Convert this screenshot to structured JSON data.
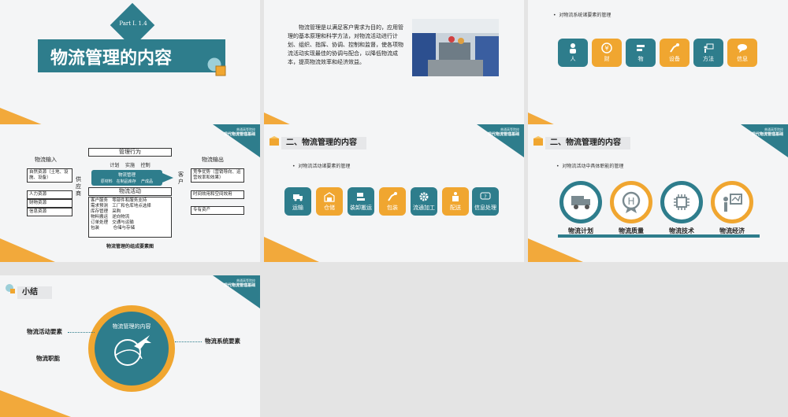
{
  "slide1": {
    "part_label": "Part I. 1.4",
    "title": "物流管理的内容"
  },
  "slide2": {
    "paragraph": "物流管理是以满足客户需求为目的，应用管理的基本原理和科学方法，对物流活动进行计划、组织、指挥、协调、控制和监督，使各项物流活动实现最佳的协调与配合，以降低物流成本，提高物流效率和经济效益。"
  },
  "slide3": {
    "bullet": "对物流系统诸要素的管理",
    "tiles": [
      {
        "label": "人",
        "color": "teal",
        "icon": "person-icon"
      },
      {
        "label": "财",
        "color": "orange",
        "icon": "money-icon"
      },
      {
        "label": "物",
        "color": "teal",
        "icon": "goods-icon"
      },
      {
        "label": "设备",
        "color": "orange",
        "icon": "robot-arm-icon"
      },
      {
        "label": "方法",
        "color": "teal",
        "icon": "presentation-icon"
      },
      {
        "label": "信息",
        "color": "orange",
        "icon": "chat-icon"
      }
    ]
  },
  "slide4": {
    "header": {
      "line1": "普通高等院校",
      "line2": "现代物流管理基础"
    },
    "input_title": "物流输入",
    "inputs": [
      "自然资源（土地、设施、设备）",
      "人力资源",
      "财物资源",
      "信息资源"
    ],
    "supplier": "供应商",
    "mgmt_title": "管理行为",
    "mgmt_items": "计划    实施    控制",
    "center_title": "物流管理",
    "center_flow": "原材料   在制品库存    产成品",
    "customer": "客户",
    "activity_title": "物流活动",
    "activities": [
      "客户服务   零部件和服务支持",
      "需求预测   工厂和仓库地点选择",
      "库存管理   采购",
      "物料搬运   逆向物流",
      "订单处理   交通与运输",
      "包装          仓储与存储"
    ],
    "output_title": "物流输出",
    "outputs": [
      "竞争优势（营销导向、运营效率和效果）",
      "时间效用和空间效用",
      "专有资产"
    ],
    "caption": "物流管理的组成要素图"
  },
  "slide5": {
    "header": {
      "line1": "普通高等院校",
      "line2": "现代物流管理基础"
    },
    "title": "二、物流管理的内容",
    "bullet": "对物流活动诸要素的管理",
    "tiles": [
      {
        "label": "运输",
        "color": "teal",
        "icon": "truck-icon"
      },
      {
        "label": "仓储",
        "color": "orange",
        "icon": "warehouse-icon"
      },
      {
        "label": "装卸搬运",
        "color": "teal",
        "icon": "handling-icon"
      },
      {
        "label": "包装",
        "color": "orange",
        "icon": "robot-arm-icon"
      },
      {
        "label": "流通加工",
        "color": "teal",
        "icon": "gear-icon"
      },
      {
        "label": "配送",
        "color": "orange",
        "icon": "delivery-icon"
      },
      {
        "label": "信息处理",
        "color": "teal",
        "icon": "info-icon"
      }
    ]
  },
  "slide6": {
    "header": {
      "line1": "普通高等院校",
      "line2": "现代物流管理基础"
    },
    "title": "二、物流管理的内容",
    "bullet": "对物流活动中具体职能的管理",
    "circles": [
      {
        "label": "物流计划",
        "color": "teal",
        "icon": "truck-icon"
      },
      {
        "label": "物流质量",
        "color": "orange",
        "icon": "quality-badge-icon"
      },
      {
        "label": "物流技术",
        "color": "teal",
        "icon": "chip-icon"
      },
      {
        "label": "物流经济",
        "color": "orange",
        "icon": "presenter-icon"
      }
    ]
  },
  "slide7": {
    "header": {
      "line1": "普通高等院校",
      "line2": "现代物流管理基础"
    },
    "title": "小结",
    "center": "物流管理的内容",
    "left1": "物流活动要素",
    "left2": "物流职能",
    "right1": "物流系统要素"
  },
  "colors": {
    "teal": "#2e7d8c",
    "orange": "#f0a630"
  }
}
